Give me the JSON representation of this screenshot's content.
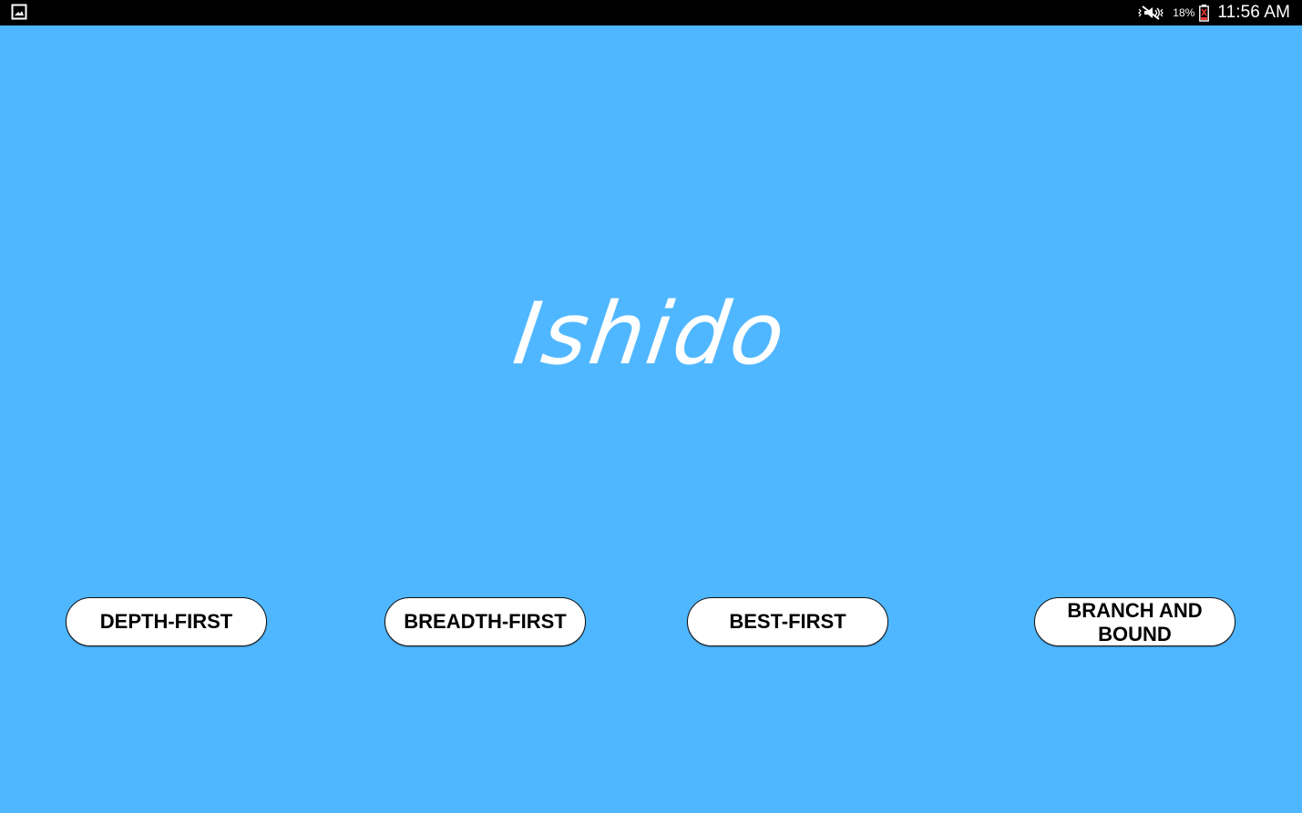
{
  "status_bar": {
    "battery_percent": "18%",
    "time": "11:56 AM",
    "left_icon": "gallery-icon",
    "sound_icon": "vibrate-mute-icon",
    "battery_icon": "battery-icon"
  },
  "app": {
    "title": "Ishido",
    "background_color": "#4fb7ff"
  },
  "buttons": [
    {
      "label": "DEPTH-FIRST"
    },
    {
      "label": "BREADTH-FIRST"
    },
    {
      "label": "BEST-FIRST"
    },
    {
      "label": "BRANCH AND BOUND"
    }
  ]
}
